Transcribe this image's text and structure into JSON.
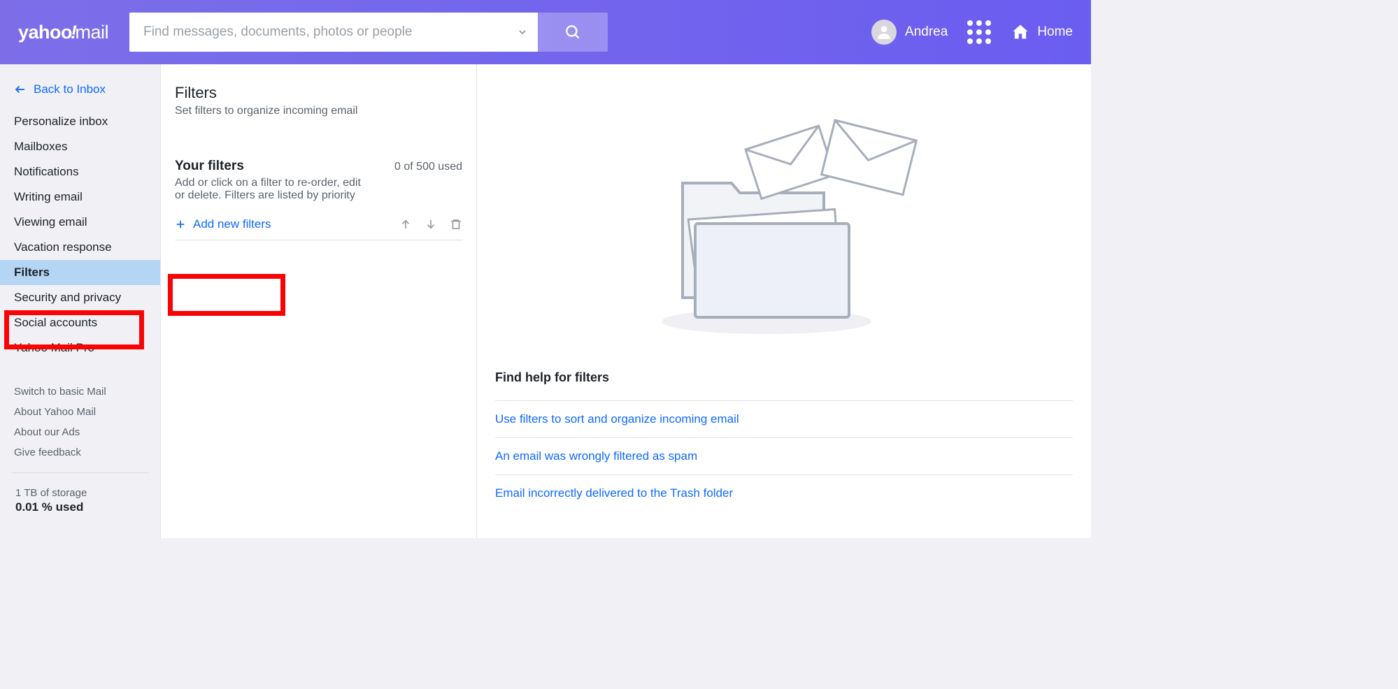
{
  "header": {
    "logo_brand": "yahoo",
    "logo_suffix": "mail",
    "search_placeholder": "Find messages, documents, photos or people",
    "account_name": "Andrea",
    "home_label": "Home"
  },
  "sidebar": {
    "back_label": "Back to Inbox",
    "items": [
      {
        "label": "Personalize inbox"
      },
      {
        "label": "Mailboxes"
      },
      {
        "label": "Notifications"
      },
      {
        "label": "Writing email"
      },
      {
        "label": "Viewing email"
      },
      {
        "label": "Vacation response"
      },
      {
        "label": "Filters",
        "active": true
      },
      {
        "label": "Security and privacy"
      },
      {
        "label": "Social accounts"
      },
      {
        "label": "Yahoo Mail Pro"
      }
    ],
    "secondary": [
      {
        "label": "Switch to basic Mail"
      },
      {
        "label": "About Yahoo Mail"
      },
      {
        "label": "About our Ads"
      },
      {
        "label": "Give feedback"
      }
    ],
    "storage": {
      "line1": "1 TB of storage",
      "line2": "0.01 % used"
    }
  },
  "main": {
    "title": "Filters",
    "subtitle": "Set filters to organize incoming email",
    "your_filters_title": "Your filters",
    "your_filters_desc": "Add or click on a filter to re-order, edit or delete. Filters are listed by priority",
    "used_count": "0 of 500 used",
    "add_new_label": "Add new filters"
  },
  "help": {
    "title": "Find help for filters",
    "links": [
      {
        "label": "Use filters to sort and organize incoming email"
      },
      {
        "label": "An email was wrongly filtered as spam"
      },
      {
        "label": "Email incorrectly delivered to the Trash folder"
      }
    ]
  }
}
